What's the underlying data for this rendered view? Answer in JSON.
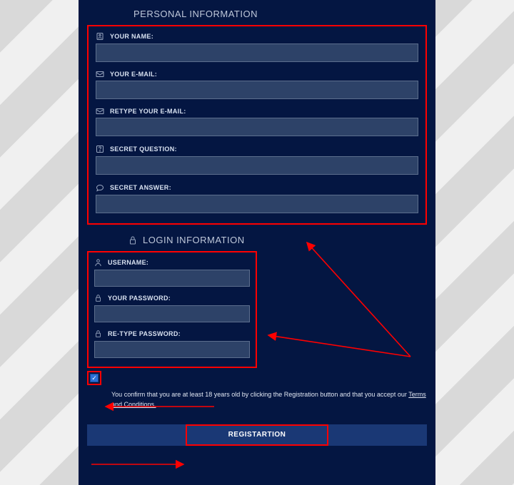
{
  "sections": {
    "personal": {
      "title": "PERSONAL INFORMATION",
      "fields": {
        "name": {
          "label": "YOUR NAME:"
        },
        "email": {
          "label": "YOUR E-MAIL:"
        },
        "email2": {
          "label": "RETYPE YOUR E-MAIL:"
        },
        "secret_q": {
          "label": "SECRET QUESTION:"
        },
        "secret_a": {
          "label": "SECRET ANSWER:"
        }
      }
    },
    "login": {
      "title": "LOGIN INFORMATION",
      "fields": {
        "username": {
          "label": "USERNAME:"
        },
        "password": {
          "label": "YOUR PASSWORD:"
        },
        "password2": {
          "label": "RE-TYPE PASSWORD:"
        }
      }
    }
  },
  "confirm": {
    "checked": true,
    "text_before": "You confirm that you are at least 18 years old by clicking the Registration button and that you accept our ",
    "link": "Terms and Conditions.",
    "text_after": ""
  },
  "register_label": "REGISTARTION",
  "colors": {
    "panel_bg": "#041642",
    "input_bg": "#2d4268",
    "highlight": "#ff0000",
    "bar_bg": "#1a3875"
  }
}
